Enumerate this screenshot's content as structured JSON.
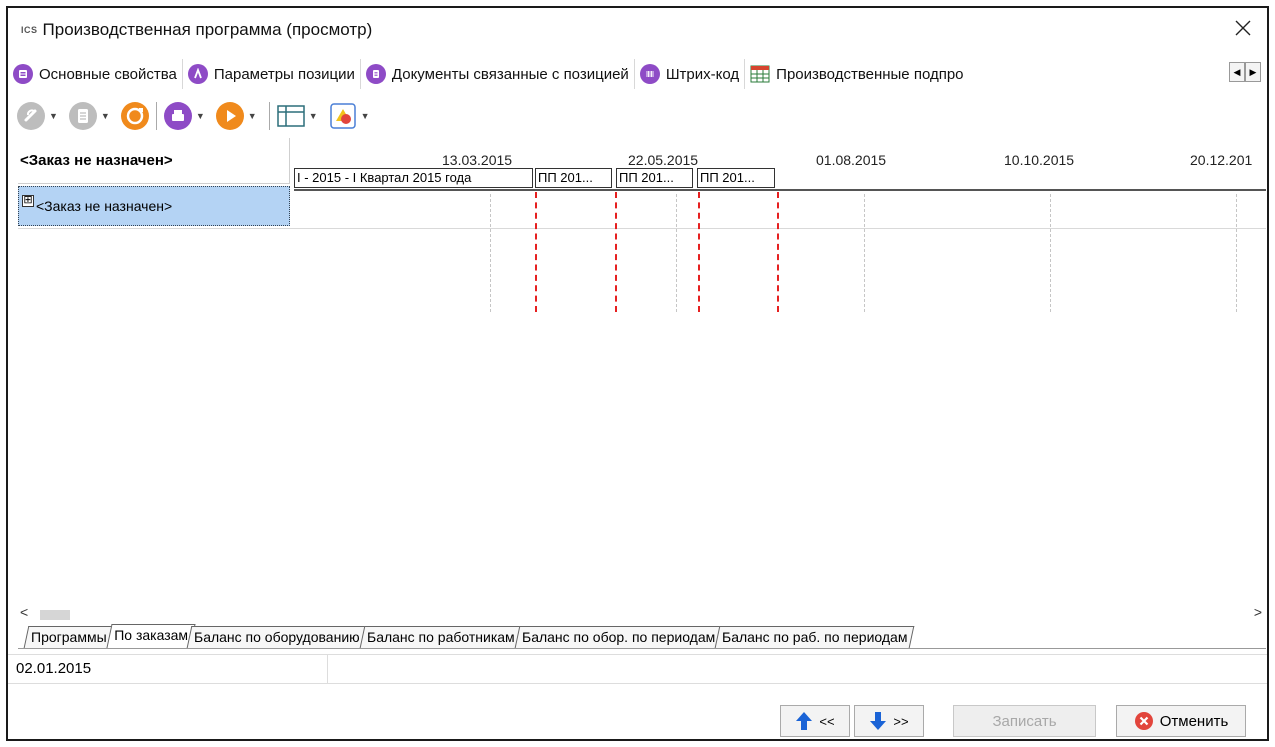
{
  "window": {
    "app_logo": "ICS",
    "title": "Производственная программа (просмотр)"
  },
  "tabs": [
    {
      "label": "Основные свойства",
      "icon": "list-icon",
      "color": "#8e4bc6"
    },
    {
      "label": "Параметры позиции",
      "icon": "parameters-icon",
      "color": "#8e4bc6"
    },
    {
      "label": "Документы связанные с позицией",
      "icon": "documents-icon",
      "color": "#8e4bc6"
    },
    {
      "label": "Штрих-код",
      "icon": "barcode-icon",
      "color": "#8e4bc6"
    },
    {
      "label": "Производственные подпро",
      "icon": "table-icon",
      "color": "#d6452e"
    }
  ],
  "gantt": {
    "left_header": "<Заказ не назначен>",
    "rows": [
      {
        "label": "<Заказ не назначен>",
        "expander": "⊞"
      }
    ],
    "dates": [
      "13.03.2015",
      "22.05.2015",
      "01.08.2015",
      "10.10.2015",
      "20.12.201"
    ],
    "periods": [
      {
        "label": "I - 2015 - I Квартал 2015 года"
      },
      {
        "label": "ПП 201..."
      },
      {
        "label": "ПП 201..."
      },
      {
        "label": "ПП 201..."
      }
    ]
  },
  "bottom_tabs": [
    {
      "label": "Программы",
      "active": false
    },
    {
      "label": "По заказам",
      "active": true
    },
    {
      "label": "Баланс по оборудованию",
      "active": false
    },
    {
      "label": "Баланс по работникам",
      "active": false
    },
    {
      "label": "Баланс по обор. по периодам",
      "active": false
    },
    {
      "label": "Баланс по раб. по периодам",
      "active": false
    }
  ],
  "status_bar": {
    "date": "02.01.2015"
  },
  "buttons": {
    "prev_label": "<<",
    "next_label": ">>",
    "save_label": "Записать",
    "cancel_label": "Отменить"
  },
  "colors": {
    "accent_purple": "#8e4bc6",
    "accent_orange": "#f08a1c",
    "selection_blue": "#b4d3f4",
    "today_line_red": "#e62020",
    "cancel_red": "#e2453c",
    "arrow_blue": "#1a63d6"
  }
}
